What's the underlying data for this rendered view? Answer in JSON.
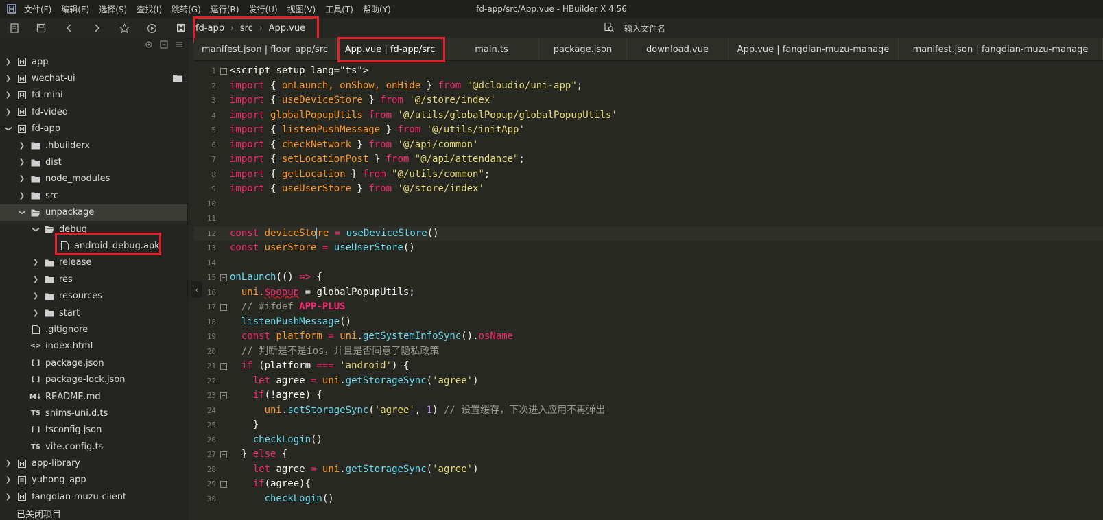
{
  "window": {
    "title": "fd-app/src/App.vue - HBuilder X 4.56"
  },
  "menu": [
    "文件(F)",
    "编辑(E)",
    "选择(S)",
    "查找(I)",
    "跳转(G)",
    "运行(R)",
    "发行(U)",
    "视图(V)",
    "工具(T)",
    "帮助(Y)"
  ],
  "breadcrumb": [
    "fd-app",
    "src",
    "App.vue"
  ],
  "search": {
    "placeholder": "输入文件名"
  },
  "sidebar": {
    "items": [
      {
        "label": "app",
        "icon": "project-icon"
      },
      {
        "label": "wechat-ui",
        "icon": "project-icon"
      },
      {
        "label": "fd-mini",
        "icon": "project-icon"
      },
      {
        "label": "fd-video",
        "icon": "project-icon"
      },
      {
        "label": "fd-app",
        "icon": "project-icon"
      },
      {
        "label": ".hbuilderx",
        "icon": "folder-icon"
      },
      {
        "label": "dist",
        "icon": "folder-icon"
      },
      {
        "label": "node_modules",
        "icon": "folder-icon"
      },
      {
        "label": "src",
        "icon": "folder-icon"
      },
      {
        "label": "unpackage",
        "icon": "folder-open-icon"
      },
      {
        "label": "debug",
        "icon": "folder-open-icon"
      },
      {
        "label": "android_debug.apk",
        "icon": "file-icon"
      },
      {
        "label": "release",
        "icon": "folder-icon"
      },
      {
        "label": "res",
        "icon": "folder-icon"
      },
      {
        "label": "resources",
        "icon": "folder-icon"
      },
      {
        "label": "start",
        "icon": "folder-icon"
      },
      {
        "label": ".gitignore",
        "icon": "file-icon"
      },
      {
        "label": "index.html",
        "icon": "html-icon"
      },
      {
        "label": "package.json",
        "icon": "json-icon"
      },
      {
        "label": "package-lock.json",
        "icon": "json-icon"
      },
      {
        "label": "README.md",
        "icon": "markdown-icon"
      },
      {
        "label": "shims-uni.d.ts",
        "icon": "ts-icon"
      },
      {
        "label": "tsconfig.json",
        "icon": "json-icon"
      },
      {
        "label": "vite.config.ts",
        "icon": "ts-icon"
      },
      {
        "label": "app-library",
        "icon": "project-icon"
      },
      {
        "label": "yuhong_app",
        "icon": "project-icon"
      },
      {
        "label": "fangdian-muzu-client",
        "icon": "project-icon"
      },
      {
        "label": "已关闭项目",
        "icon": "none"
      }
    ]
  },
  "tabs": [
    {
      "label": "manifest.json | floor_app/src"
    },
    {
      "label": "App.vue | fd-app/src"
    },
    {
      "label": "main.ts"
    },
    {
      "label": "package.json"
    },
    {
      "label": "download.vue"
    },
    {
      "label": "App.vue | fangdian-muzu-manage"
    },
    {
      "label": "manifest.json | fangdian-muzu-manage"
    }
  ],
  "code": {
    "line_numbers": [
      "1",
      "2",
      "3",
      "4",
      "5",
      "6",
      "7",
      "8",
      "9",
      "10",
      "11",
      "12",
      "13",
      "14",
      "15",
      "16",
      "17",
      "18",
      "19",
      "20",
      "21",
      "22",
      "23",
      "24",
      "25",
      "26",
      "27",
      "28",
      "29",
      "30"
    ],
    "l1a": "<script setup lang=\"ts\">",
    "import_kw": "import",
    "from_kw": "from",
    "l2_ids": "onLaunch, onShow, onHide",
    "l2_src": "\"@dcloudio/uni-app\"",
    "l3_id": "useDeviceStore",
    "l3_src": "'@/store/index'",
    "l4_id": "globalPopupUtils",
    "l4_src": "'@/utils/globalPopup/globalPopupUtils'",
    "l5_id": "listenPushMessage",
    "l5_src": "'@/utils/initApp'",
    "l6_id": "checkNetwork",
    "l6_src": "'@/api/common'",
    "l7_id": "setLocationPost",
    "l7_src": "\"@/api/attendance\"",
    "l8_id": "getLocation",
    "l8_src": "\"@/utils/common\"",
    "l9_id": "useUserStore",
    "l9_src": "'@/store/index'",
    "const_kw": "const",
    "l12_a": "deviceSto",
    "l12_b": "re",
    "l12_fn": "useDeviceStore",
    "l13_var": "userStore",
    "l13_fn": "useUserStore",
    "l15_fn": "onLaunch",
    "l16_a": "uni.",
    "l16_err": "$popup",
    "l16_b": " = globalPopupUtils;",
    "l17_cmt": "// #ifdef ",
    "l17_macro": "APP-PLUS",
    "l18_fn": "listenPushMessage",
    "l19_var": "platform",
    "l19_fn": "getSystemInfoSync",
    "l19_prop": "osName",
    "l20_cmt": "// 判断是不是ios，并且是否同意了隐私政策",
    "l21_str": "'android'",
    "l22_fn": "getStorageSync",
    "l22_str": "'agree'",
    "l24_fn": "setStorageSync",
    "l24_str": "'agree'",
    "l24_num": "1",
    "l24_cmt": "// 设置缓存，下次进入应用不再弹出",
    "l26_fn": "checkLogin"
  },
  "colors": {
    "highlight_box": "#e3202a",
    "editor_bg": "#272822",
    "keyword": "#f92672",
    "function": "#66d9ef",
    "string": "#e6db74"
  }
}
